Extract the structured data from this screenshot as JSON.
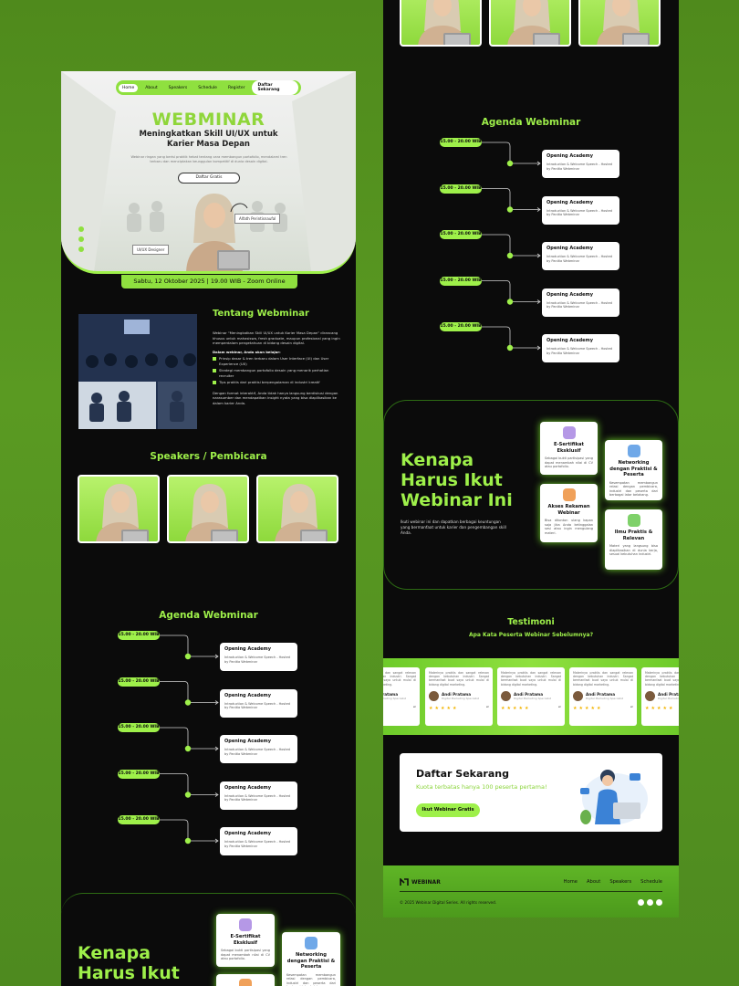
{
  "nav": {
    "items": [
      "Home",
      "About",
      "Speakers",
      "Schedule",
      "Register"
    ],
    "cta": "Daftar Sekarang"
  },
  "hero": {
    "title": "WEBMINAR",
    "subtitle": "Meningkatkan Skill UI/UX untuk Karier Masa Depan",
    "desc": "Webinar ringan yang berisi praktik hebat tentang cara membangun portofolio, mendalami tren terbaru dan menciptakan keunggulan kompetitif di dunia desain digital.",
    "cta": "Daftar Gratis",
    "tag_right": "Alfath Perintisnaufal",
    "tag_left": "UI/UX Designer",
    "date": "Sabtu, 12 Oktober 2025 | 19.00 WIB - Zoom Online"
  },
  "about": {
    "title": "Tentang Webminar",
    "p1": "Webinar \"Meningkatkan Skill UI/UX untuk Karier Masa Depan\" dirancang khusus untuk mahasiswa, fresh graduate, maupun profesional yang ingin memperdalam pengetahuan di bidang desain digital.",
    "list_title": "Dalam webinar, Anda akan belajar:",
    "points": [
      "Prinsip dasar & tren terbaru dalam User Interface (UI) dan User Experience (UX)",
      "Strategi membangun portofolio desain yang menarik perhatian recruiter",
      "Tips praktis dari praktisi berpengalaman di industri kreatif"
    ],
    "p2": "Dengan format interaktif, Anda tidak hanya langsung berdiskusi dengan narasumber dan mendapatkan insight nyata yang bisa diaplikasikan ke dalam karier Anda."
  },
  "speakers": {
    "title": "Speakers / Pembicara",
    "count": 3
  },
  "agenda": {
    "title": "Agenda Webminar",
    "items": [
      {
        "time": "15.00 - 20.00 WIB",
        "title": "Opening Academy",
        "desc": "Introduction & Welcome Speech - Hosted by Panitia Webminar"
      },
      {
        "time": "15.00 - 20.00 WIB",
        "title": "Opening Academy",
        "desc": "Introduction & Welcome Speech - Hosted by Panitia Webminar"
      },
      {
        "time": "15.00 - 20.00 WIB",
        "title": "Opening Academy",
        "desc": "Introduction & Welcome Speech - Hosted by Panitia Webminar"
      },
      {
        "time": "15.00 - 20.00 WIB",
        "title": "Opening Academy",
        "desc": "Introduction & Welcome Speech - Hosted by Panitia Webminar"
      },
      {
        "time": "15.00 - 20.00 WIB",
        "title": "Opening Academy",
        "desc": "Introduction & Welcome Speech - Hosted by Panitia Webminar"
      }
    ]
  },
  "why": {
    "title_l1": "Kenapa",
    "title_l2": "Harus Ikut",
    "title_l3": "Webinar Ini",
    "desc": "Ikuti webinar ini dan dapatkan berbagai keuntungan yang bermanfaat untuk karier dan pengembangan skill Anda.",
    "cards": [
      {
        "title": "E-Sertifikat Eksklusif",
        "desc": "Sebagai bukti partisipasi yang dapat menambah nilai di CV atau portofolio."
      },
      {
        "title": "Networking dengan Praktisi & Peserta",
        "desc": "Kesempatan membangun relasi dengan pembicara, industri dan peserta dari berbagai latar belakang."
      },
      {
        "title": "Akses Rekaman Webinar",
        "desc": "Bisa ditonton ulang kapan saja jika Anda ketinggalan sesi atau ingin mengulang materi."
      },
      {
        "title": "Ilmu Praktis & Relevan",
        "desc": "Materi yang langsung bisa diaplikasikan di dunia kerja, sesuai kebutuhan industri."
      }
    ]
  },
  "testimoni": {
    "title": "Testimoni",
    "subtitle": "Apa Kata Peserta Webinar Sebelumnya?",
    "quote": "Materinya praktis dan sangat relevan dengan kebutuhan industri. Sangat bermanfaat buat saya untuk mulai di bidang digital marketing.",
    "name": "Andi Pratama",
    "role": "Digital Marketing Specialist"
  },
  "cta": {
    "title": "Daftar Sekarang",
    "sub": "Kuota terbatas hanya 100 peserta pertama!",
    "button": "Ikut Webinar Gratis"
  },
  "footer": {
    "brand": "WEBINAR",
    "links": [
      "Home",
      "About",
      "Speakers",
      "Schedule"
    ],
    "copyright": "© 2025 Webinar Digital Series. All rights reserved."
  },
  "colors": {
    "accent": "#9ef04a",
    "background": "#0b0b0b",
    "page": "#5a9a22"
  }
}
